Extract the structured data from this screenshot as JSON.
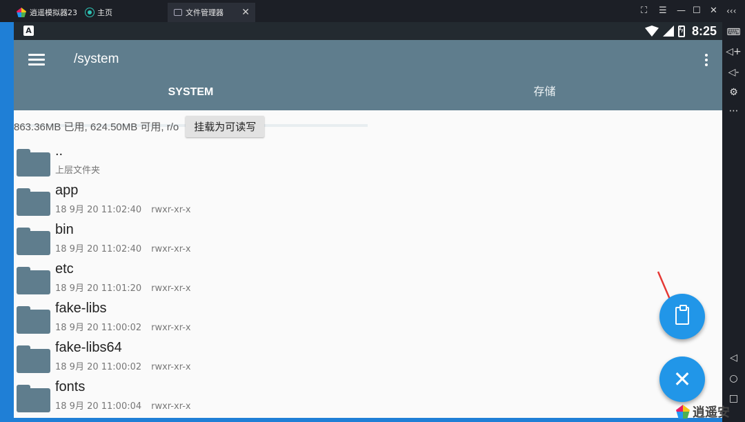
{
  "emulator": {
    "app_tab": "逍遥模拟器23",
    "tabs": [
      {
        "label": "主页",
        "icon": "home-icon"
      },
      {
        "label": "文件管理器",
        "icon": "file-manager-icon",
        "active": true
      }
    ],
    "window_controls": [
      "screenshot-icon",
      "menu-icon",
      "minimize-icon",
      "maximize-icon",
      "close-icon"
    ],
    "collapse_label": "‹‹‹",
    "sidebar": [
      "keyboard-icon",
      "volume-up-icon",
      "volume-down-icon",
      "settings-icon",
      "more-icon",
      "back-icon",
      "home-icon",
      "recents-icon"
    ]
  },
  "status_bar": {
    "time": "8:25",
    "notification": "A"
  },
  "app_bar": {
    "path": "/system",
    "tabs": [
      {
        "label": "SYSTEM",
        "selected": true
      },
      {
        "label": "存储",
        "selected": false
      }
    ]
  },
  "storage": {
    "info": "863.36MB 已用, 624.50MB 可用, r/o",
    "mount_button": "挂载为可读写"
  },
  "files": [
    {
      "name": "..",
      "meta": "上层文件夹",
      "perm": ""
    },
    {
      "name": "app",
      "meta": "18 9月 20 11:02:40",
      "perm": "rwxr-xr-x"
    },
    {
      "name": "bin",
      "meta": "18 9月 20 11:02:40",
      "perm": "rwxr-xr-x"
    },
    {
      "name": "etc",
      "meta": "18 9月 20 11:01:20",
      "perm": "rwxr-xr-x"
    },
    {
      "name": "fake-libs",
      "meta": "18 9月 20 11:00:02",
      "perm": "rwxr-xr-x"
    },
    {
      "name": "fake-libs64",
      "meta": "18 9月 20 11:00:02",
      "perm": "rwxr-xr-x"
    },
    {
      "name": "fonts",
      "meta": "18 9月 20 11:00:04",
      "perm": "rwxr-xr-x"
    }
  ],
  "fabs": [
    "clipboard-icon",
    "close-icon"
  ],
  "watermark": "逍遥安",
  "colors": {
    "app_bar": "#5f7d8d",
    "fab": "#2196e8",
    "arrow": "#e53935",
    "desktop": "#1f7fd6"
  }
}
